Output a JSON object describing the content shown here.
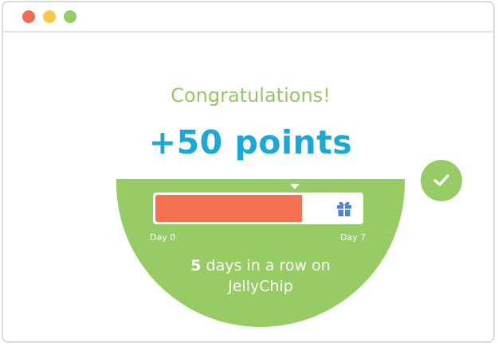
{
  "colors": {
    "dot_red": "#f26b55",
    "dot_yellow": "#f8c84a",
    "dot_green": "#93cf61",
    "green": "#96cc63",
    "congrats_text": "#92c862",
    "points_text": "#1aa8d8",
    "bar_fill": "#f47152",
    "gift": "#4d82d8"
  },
  "header": {
    "congrats": "Congratulations!",
    "points": "+50 points"
  },
  "progress": {
    "current_day": 5,
    "total_days": 7,
    "fraction": 0.714,
    "start_label": "Day 0",
    "end_label": "Day 7",
    "reward_icon": "gift-icon"
  },
  "streak": {
    "count": "5",
    "text_line1": " days in a row on",
    "text_line2": "JellyChip"
  },
  "badge": {
    "icon": "checkmark-icon"
  }
}
